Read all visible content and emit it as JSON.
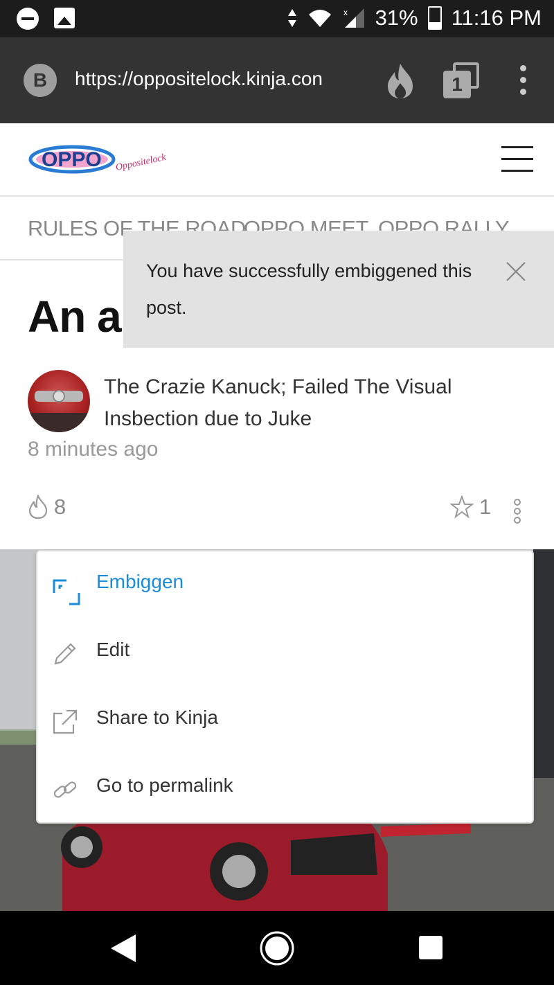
{
  "status_bar": {
    "battery": "31%",
    "time": "11:16 PM"
  },
  "browser": {
    "badge": "B",
    "url": "https://oppositelock.kinja.con",
    "tab_count": "1"
  },
  "site": {
    "logo_text": "OPPO",
    "logo_script": "Oppositelock",
    "nav": [
      "RULES OF THE ROAD",
      "OPPO MEET",
      "OPPO RALLY"
    ]
  },
  "toast": {
    "message": "You have successfully embiggened this post."
  },
  "article": {
    "headline": "An ar",
    "author": "The Crazie Kanuck; Failed The Visual Insbection due to Juke",
    "timestamp": "8 minutes ago",
    "likes": "8",
    "stars": "1"
  },
  "menu": {
    "items": [
      {
        "label": "Embiggen",
        "icon": "embiggen-icon",
        "active": true
      },
      {
        "label": "Edit",
        "icon": "pencil-icon"
      },
      {
        "label": "Share to Kinja",
        "icon": "share-icon"
      },
      {
        "label": "Go to permalink",
        "icon": "link-icon"
      }
    ]
  },
  "colors": {
    "accent": "#1a8cd8",
    "toast_bg": "#e2e2e2",
    "browser_bar": "#333333"
  }
}
